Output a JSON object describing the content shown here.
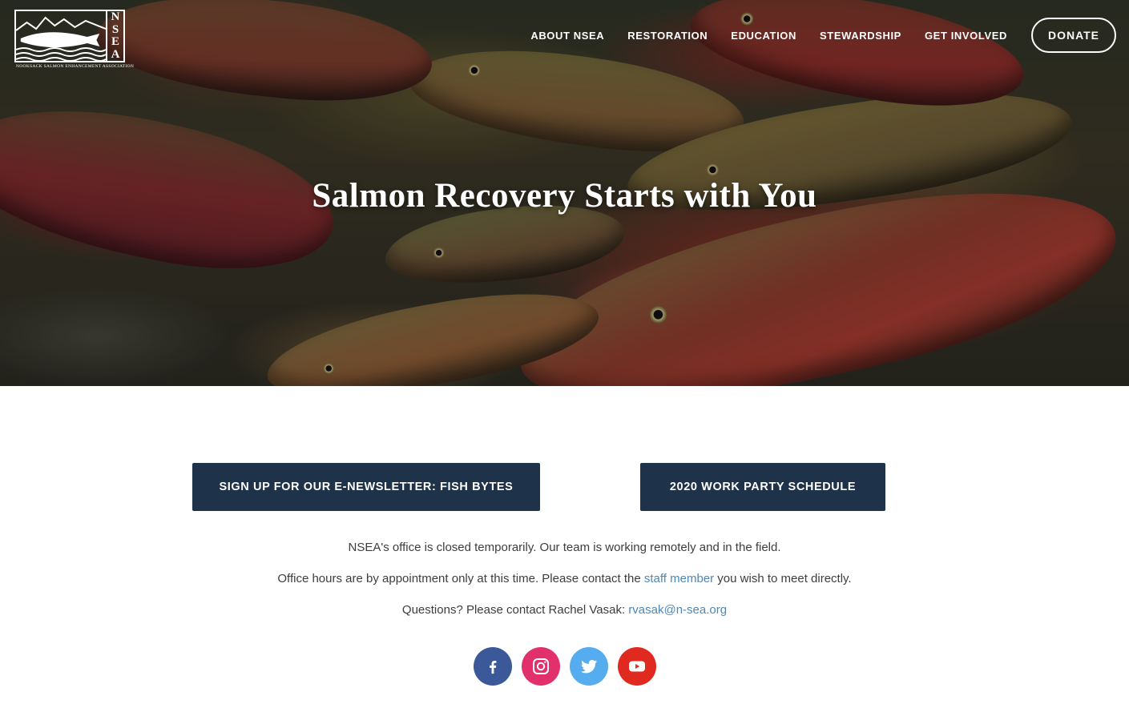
{
  "logo": {
    "letters": [
      "N",
      "S",
      "E",
      "A"
    ],
    "tagline": "NOOKSACK SALMON ENHANCEMENT ASSOCIATION"
  },
  "nav": {
    "items": [
      {
        "label": "ABOUT NSEA"
      },
      {
        "label": "RESTORATION"
      },
      {
        "label": "EDUCATION"
      },
      {
        "label": "STEWARDSHIP"
      },
      {
        "label": "GET INVOLVED"
      }
    ],
    "donate_label": "DONATE"
  },
  "hero": {
    "title": "Salmon Recovery Starts with You"
  },
  "buttons": {
    "newsletter": "SIGN UP FOR OUR E-NEWSLETTER: FISH BYTES",
    "schedule": "2020 WORK PARTY SCHEDULE"
  },
  "info": {
    "line1": "NSEA's office is closed temporarily.  Our team is working remotely and in the field.",
    "line2_before": "Office hours are by appointment only at this time.  Please contact the ",
    "line2_link": "staff member",
    "line2_after": " you wish to meet directly.",
    "line3_before": "Questions? Please contact Rachel Vasak: ",
    "line3_link": "rvasak@n-sea.org"
  },
  "social": [
    {
      "icon": "facebook-icon",
      "color": "#3b5998"
    },
    {
      "icon": "instagram-icon",
      "color": "#e1306c"
    },
    {
      "icon": "twitter-icon",
      "color": "#55acee"
    },
    {
      "icon": "youtube-icon",
      "color": "#e02a20"
    }
  ]
}
